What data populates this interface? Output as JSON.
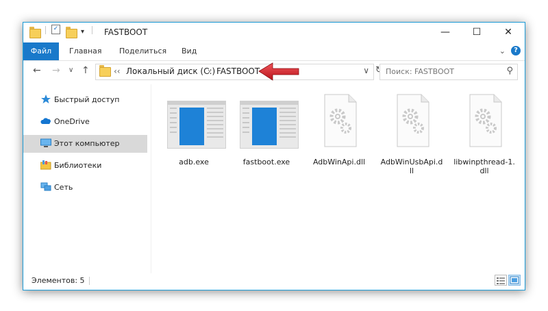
{
  "window": {
    "title": "FASTBOOT"
  },
  "ribbon": {
    "tabs": [
      "Файл",
      "Главная",
      "Поделиться",
      "Вид"
    ]
  },
  "address": {
    "overflow": "‹‹",
    "crumbs": [
      "Локальный диск (C:)",
      "FASTBOOT"
    ],
    "separator": "›"
  },
  "search": {
    "placeholder": "Поиск: FASTBOOT"
  },
  "navpane": {
    "items": [
      {
        "label": "Быстрый доступ",
        "icon": "star-icon"
      },
      {
        "label": "OneDrive",
        "icon": "cloud-icon"
      },
      {
        "label": "Этот компьютер",
        "icon": "computer-icon",
        "selected": true
      },
      {
        "label": "Библиотеки",
        "icon": "library-icon"
      },
      {
        "label": "Сеть",
        "icon": "network-icon"
      }
    ]
  },
  "files": [
    {
      "name": "adb.exe",
      "type": "exe"
    },
    {
      "name": "fastboot.exe",
      "type": "exe"
    },
    {
      "name": "AdbWinApi.dll",
      "type": "dll"
    },
    {
      "name": "AdbWinUsbApi.dll",
      "display_lines": [
        "AdbWinUsbApi.d",
        "ll"
      ],
      "type": "dll"
    },
    {
      "name": "libwinpthread-1.dll",
      "display_lines": [
        "libwinpthread-1.",
        "dll"
      ],
      "type": "dll"
    }
  ],
  "status": {
    "items_text": "Элементов: 5"
  },
  "colors": {
    "accent": "#1979ca",
    "arrow": "#d8232a",
    "selection": "#d9d9d9"
  }
}
